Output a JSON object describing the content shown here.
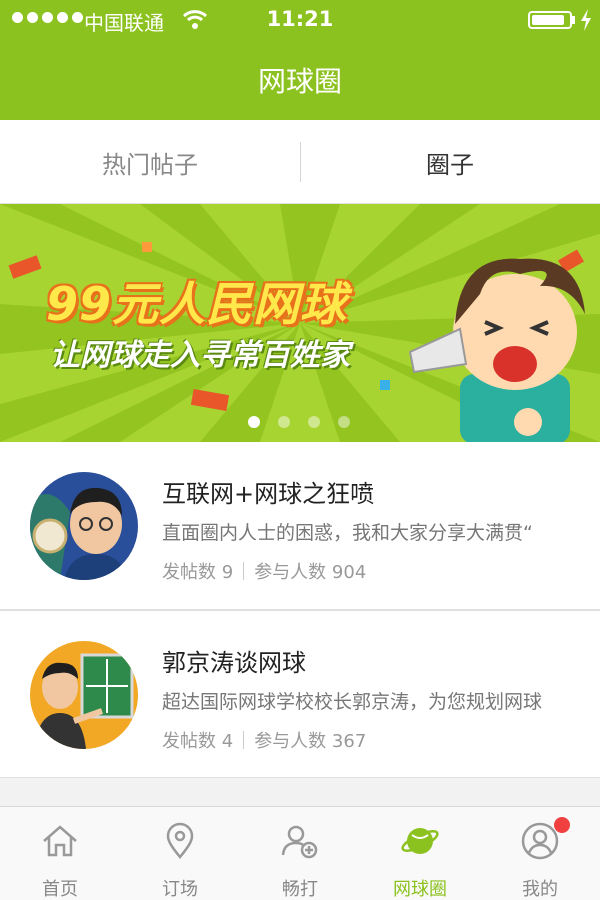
{
  "status_bar": {
    "carrier": "中国联通",
    "time": "11:21"
  },
  "header": {
    "title": "网球圈"
  },
  "tabs": [
    {
      "label": "热门帖子",
      "active": false
    },
    {
      "label": "圈子",
      "active": true
    }
  ],
  "banner": {
    "headline": "99元人民网球",
    "subline": "让网球走入寻常百姓家",
    "page_count": 4,
    "current_page": 1
  },
  "circles": [
    {
      "name": "互联网+网球之狂喷",
      "description": "直面圈内人士的困惑，我和大家分享大满贯“",
      "posts_label": "发帖数 9",
      "members_label": "参与人数 904"
    },
    {
      "name": "郭京涛谈网球",
      "description": "超达国际网球学校校长郭京涛，为您规划网球",
      "posts_label": "发帖数 4",
      "members_label": "参与人数 367"
    }
  ],
  "tabbar": {
    "items": [
      {
        "label": "首页",
        "icon": "home-icon",
        "active": false
      },
      {
        "label": "订场",
        "icon": "location-pin-icon",
        "active": false
      },
      {
        "label": "畅打",
        "icon": "add-friend-icon",
        "active": false
      },
      {
        "label": "网球圈",
        "icon": "planet-icon",
        "active": true
      },
      {
        "label": "我的",
        "icon": "profile-icon",
        "active": false,
        "badge": true
      }
    ]
  },
  "colors": {
    "brand": "#8cc21f",
    "badge": "#f04040"
  }
}
